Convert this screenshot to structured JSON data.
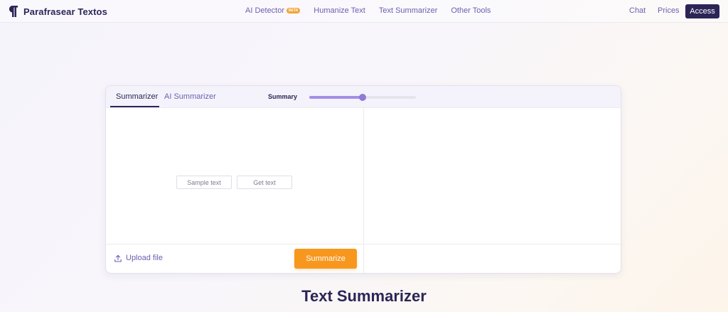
{
  "header": {
    "brand": "Parafrasear Textos",
    "logo_icon": "pilcrow-icon",
    "nav": [
      {
        "label": "AI Detector",
        "badge": "BETA"
      },
      {
        "label": "Humanize Text"
      },
      {
        "label": "Text Summarizer"
      },
      {
        "label": "Other Tools"
      }
    ],
    "chat": "Chat",
    "prices": "Prices",
    "access": "Access"
  },
  "tool": {
    "tabs": [
      "Summarizer",
      "AI Summarizer"
    ],
    "active_tab": "Summarizer",
    "summary_label": "Summary",
    "summary_level": 0.5,
    "sample_button": "Sample text",
    "get_button": "Get text",
    "upload_label": "Upload file",
    "upload_icon": "upload-icon",
    "summarize_button": "Summarize"
  },
  "heading": "Text Summarizer",
  "colors": {
    "brand_dark": "#2b2557",
    "link_purple": "#6b5fb0",
    "accent_orange": "#f7971e",
    "slider_purple": "#8e7ad8",
    "beta_orange": "#f2a43a"
  }
}
